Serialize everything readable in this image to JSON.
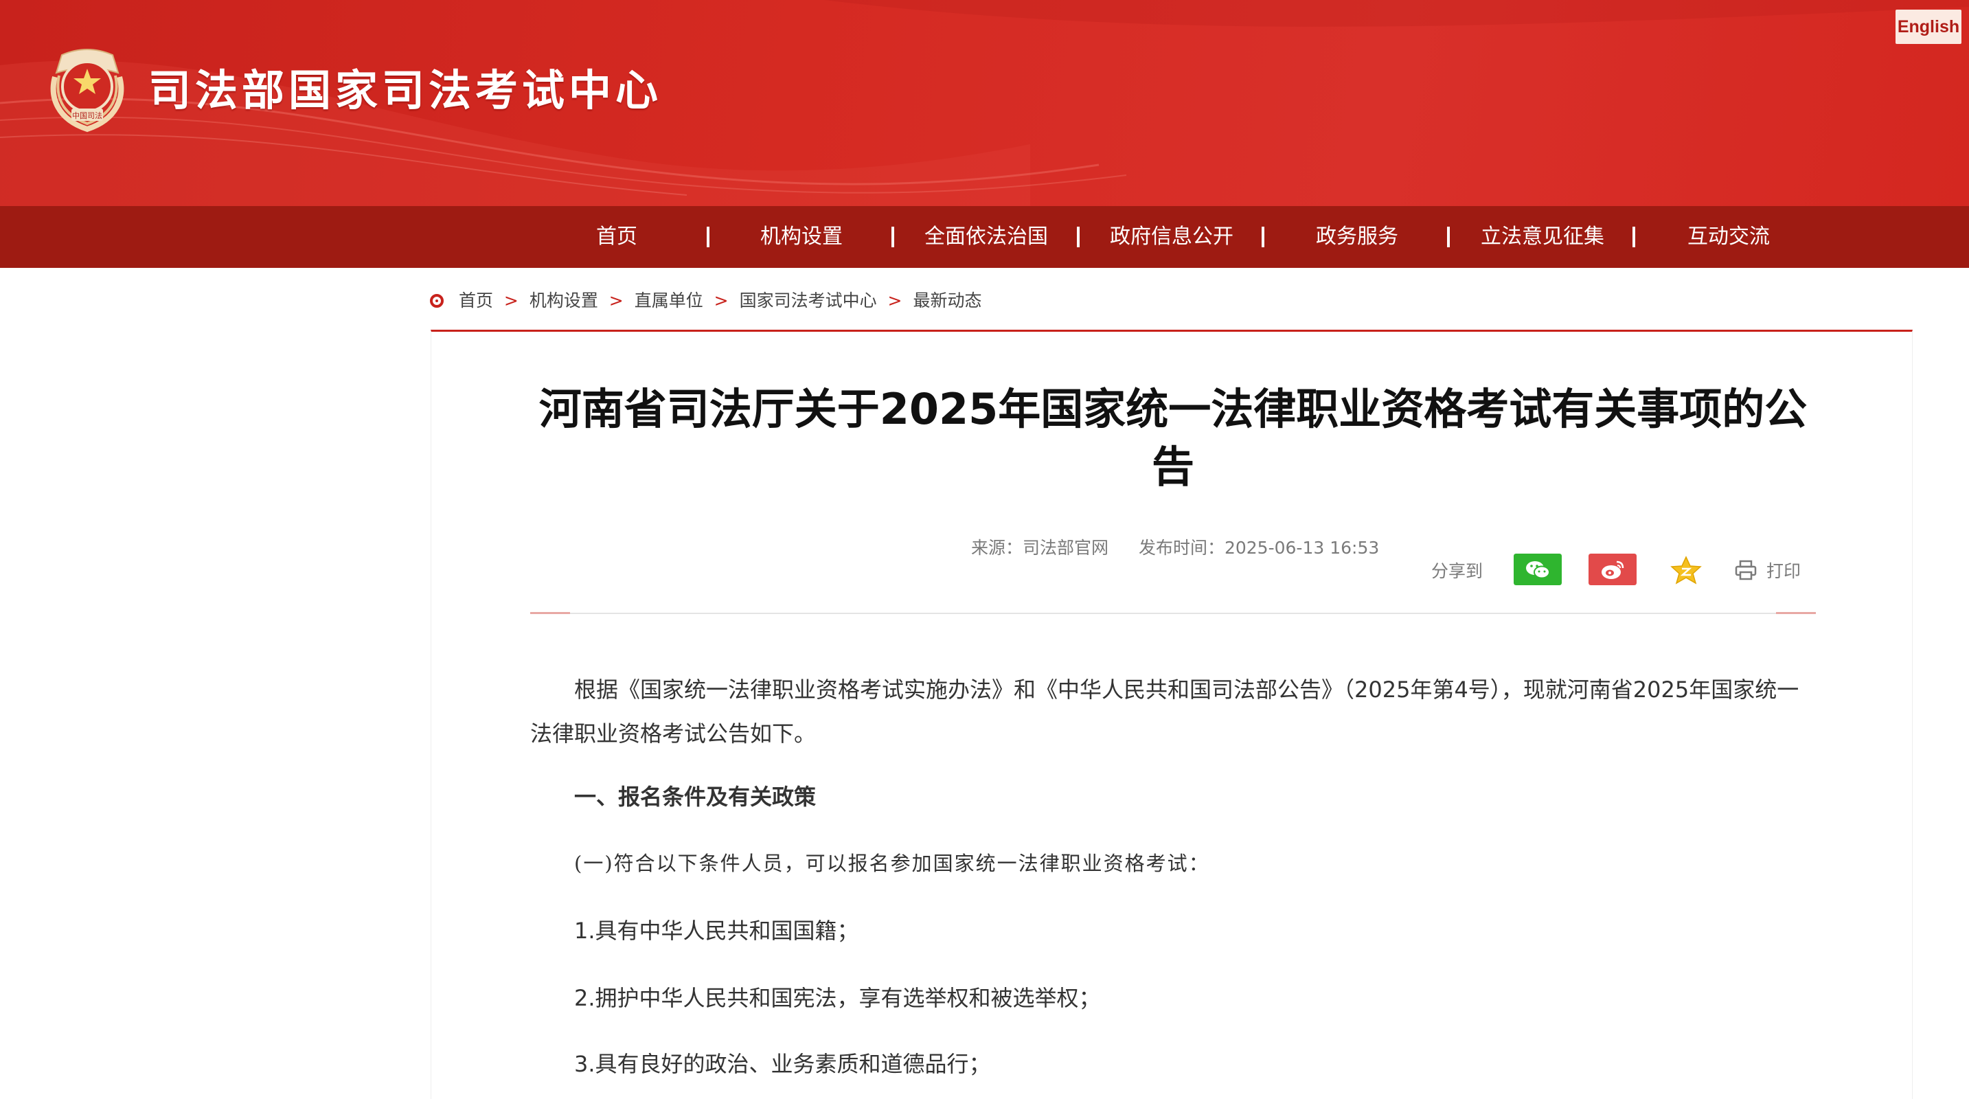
{
  "header": {
    "site_title": "司法部国家司法考试中心",
    "emblem_caption": "中国司法",
    "language_button": "English"
  },
  "nav": {
    "items": [
      "首页",
      "机构设置",
      "全面依法治国",
      "政府信息公开",
      "政务服务",
      "立法意见征集",
      "互动交流"
    ]
  },
  "breadcrumb": {
    "items": [
      "首页",
      "机构设置",
      "直属单位",
      "国家司法考试中心",
      "最新动态"
    ],
    "separator": ">"
  },
  "article": {
    "title": "河南省司法厅关于2025年国家统一法律职业资格考试有关事项的公告",
    "source": "来源：司法部官网",
    "published": "发布时间：2025-06-13 16:53",
    "share_label": "分享到",
    "share_buttons": [
      "wechat-icon",
      "weibo-icon",
      "qzone-icon"
    ],
    "print_label": "打印",
    "paragraph_intro": "根据《国家统一法律职业资格考试实施办法》和《中华人民共和国司法部公告》（2025年第4号），现就河南省2025年国家统一法律职业资格考试公告如下。",
    "section_heading": "一、报名条件及有关政策",
    "sub_heading": "(一)符合以下条件人员，可以报名参加国家统一法律职业资格考试：",
    "items": [
      "1.具有中华人民共和国国籍；",
      "2.拥护中华人民共和国宪法，享有选举权和被选举权；",
      "3.具有良好的政治、业务素质和道德品行；"
    ]
  },
  "colors": {
    "brand_red": "#c8221c",
    "nav_dark_red": "#9e1b12",
    "wechat_green": "#2fb52f",
    "weibo_red": "#e24a4a",
    "qzone_yellow": "#f5c020"
  }
}
